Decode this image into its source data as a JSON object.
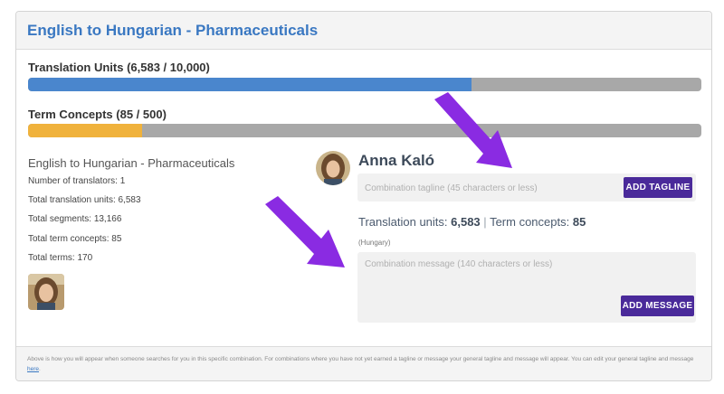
{
  "header": {
    "title": "English to Hungarian - Pharmaceuticals"
  },
  "meters": {
    "translation_units": {
      "label": "Translation Units (6,583 / 10,000)",
      "fraction": 0.6583,
      "color": "#4a86cd"
    },
    "term_concepts": {
      "label": "Term Concepts (85 / 500)",
      "fraction": 0.17,
      "color": "#f0b23c"
    }
  },
  "combo": {
    "title": "English to Hungarian - Pharmaceuticals",
    "stats": [
      "Number of translators: 1",
      "Total translation units: 6,583",
      "Total segments: 13,166",
      "Total term concepts: 85",
      "Total terms: 170"
    ]
  },
  "profile": {
    "name": "Anna Kaló",
    "tagline_placeholder": "Combination tagline (45 characters or less)",
    "add_tagline_label": "ADD TAGLINE",
    "units_prefix": "Translation units: ",
    "units_value": "6,583",
    "separator": "|",
    "concepts_prefix": "Term concepts: ",
    "concepts_value": "85",
    "country": "(Hungary)",
    "message_placeholder": "Combination message (140 characters or less)",
    "add_message_label": "ADD MESSAGE"
  },
  "footer": {
    "text": "Above is how you will appear when someone searches for you in this specific combination. For combinations where you have not yet earned a tagline or message your general tagline and message will appear. You can edit your general tagline and message ",
    "link": "here",
    "end": "."
  },
  "colors": {
    "accent_blue": "#3a78c2",
    "button_purple": "#4a2a9a",
    "arrow_purple": "#8a2be2"
  }
}
